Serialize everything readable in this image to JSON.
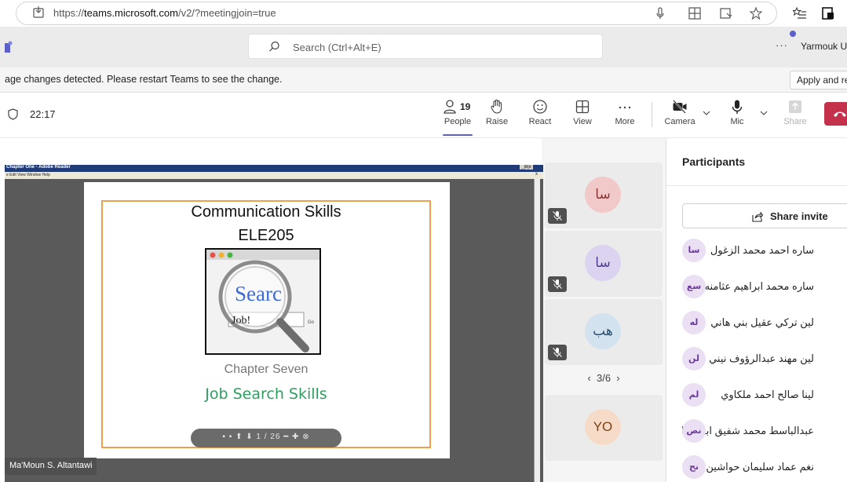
{
  "browser": {
    "url_prefix": "https://",
    "url_domain": "teams.microsoft.com",
    "url_path": "/v2/?meetingjoin=true"
  },
  "teams": {
    "search_placeholder": "Search (Ctrl+Alt+E)",
    "more_label": "···",
    "org_name": "Yarmouk Un"
  },
  "notice": {
    "text": "age changes detected. Please restart Teams to see the change.",
    "apply_label": "Apply and re"
  },
  "meeting": {
    "time": "22:17",
    "people_count": "19",
    "buttons": {
      "people": "People",
      "raise": "Raise",
      "react": "React",
      "view": "View",
      "more": "More",
      "camera": "Camera",
      "mic": "Mic",
      "share": "Share"
    }
  },
  "shared_content": {
    "reader_title": "Chapter One - Adobe Reader",
    "reader_menu": "e  Edit  View  Window  Help",
    "window_buttons": "_|8|x",
    "close_x": "x",
    "slide_title": "Communication Skills",
    "slide_code": "ELE205",
    "search_word": "Searc",
    "search_box_text": "Job!",
    "search_go": "Go",
    "chapter": "Chapter Seven",
    "topic": "Job Search Skills",
    "nav_current": "1",
    "nav_total": "/ 26",
    "presenter": "Ma'Moun S. Altantawi"
  },
  "tiles": [
    {
      "initials": "سا",
      "muted": true,
      "color": "#f1c9c9",
      "text_color": "#8a3232"
    },
    {
      "initials": "سا",
      "muted": true,
      "color": "#dcd3f1",
      "text_color": "#4f3a8f"
    },
    {
      "initials": "هب",
      "muted": true,
      "color": "#d3e2ef",
      "text_color": "#2d4f6e"
    },
    {
      "initials": "YO",
      "muted": false,
      "color": "#f6dcc8",
      "text_color": "#7a3f16"
    }
  ],
  "tile_pager": {
    "current": "3",
    "total": "6"
  },
  "participants": {
    "title": "Participants",
    "share_invite": "Share invite",
    "list": [
      {
        "initials": "سا",
        "name": "ساره احمد محمد الزغول"
      },
      {
        "initials": "سع",
        "name": "ساره محمد ابراهيم عثامنه"
      },
      {
        "initials": "له",
        "name": "لين تركي عقيل بني هاني"
      },
      {
        "initials": "لن",
        "name": "لين مهند عبدالرؤوف نيني"
      },
      {
        "initials": "لم",
        "name": "لينا صالح احمد ملكاوي"
      },
      {
        "initials": "نص",
        "name": "عبدالباسط محمد شفيق ابو صفا"
      },
      {
        "initials": "نح",
        "name": "نغم عماد سليمان حواشين"
      }
    ]
  },
  "colors": {
    "accent": "#5b5fc7",
    "leave_red": "#c4314b",
    "slide_border": "#f0a04b",
    "topic_green": "#2e9e5f"
  }
}
